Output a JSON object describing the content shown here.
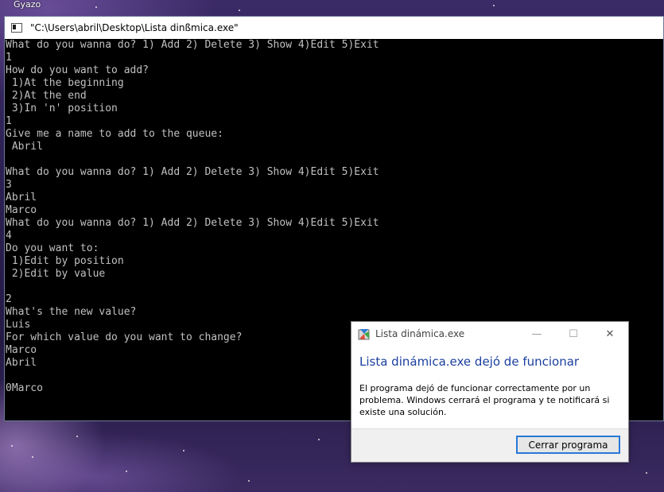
{
  "desktop": {
    "gyazo_label": "Gyazo"
  },
  "console": {
    "title": "\"C:\\Users\\abril\\Desktop\\Lista dinßmica.exe\"",
    "lines": [
      "What do you wanna do? 1) Add 2) Delete 3) Show 4)Edit 5)Exit",
      "1",
      "How do you want to add?",
      " 1)At the beginning",
      " 2)At the end",
      " 3)In 'n' position",
      "1",
      "Give me a name to add to the queue:",
      " Abril",
      "",
      "What do you wanna do? 1) Add 2) Delete 3) Show 4)Edit 5)Exit",
      "3",
      "Abril",
      "Marco",
      "What do you wanna do? 1) Add 2) Delete 3) Show 4)Edit 5)Exit",
      "4",
      "Do you want to:",
      " 1)Edit by position",
      " 2)Edit by value",
      "",
      "2",
      "What's the new value?",
      "Luis",
      "For which value do you want to change?",
      "Marco",
      "Abril",
      "",
      "0Marco"
    ]
  },
  "dialog": {
    "title": "Lista dinámica.exe",
    "heading": "Lista dinámica.exe dejó de funcionar",
    "message": "El programa dejó de funcionar correctamente por un problema. Windows cerrará el programa y te notificará si existe una solución.",
    "close_button": "Cerrar programa",
    "controls": {
      "minimize": "—",
      "maximize": "☐",
      "close": "✕"
    }
  }
}
